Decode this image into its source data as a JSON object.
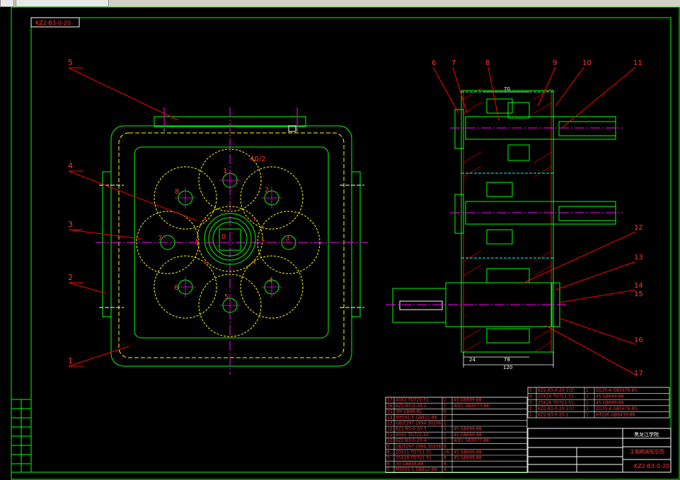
{
  "drawing": {
    "code_label": "KZ2-B3-0-20",
    "title_code": "KZ2-B3-0-20",
    "school": "黑龙江学院",
    "drawing_name": "主轴箱装配总图"
  },
  "front_view": {
    "leaders": [
      "5",
      "4",
      "3",
      "2",
      "1"
    ],
    "gear_labels": [
      "1",
      "2",
      "3",
      "4",
      "5",
      "6",
      "7",
      "8",
      "0"
    ],
    "annotation": "40/2"
  },
  "side_view": {
    "leaders": [
      "6",
      "7",
      "8",
      "9",
      "10",
      "11",
      "12",
      "13",
      "14",
      "15",
      "16",
      "17"
    ],
    "dims": [
      "70",
      "24",
      "78",
      "120"
    ]
  },
  "parts_list": [
    {
      "no": "17",
      "code": "40X2 TD721-51",
      "qty": "2",
      "material": "45 GB699-88"
    },
    {
      "no": "16",
      "code": "KZ2-B3-0-20-2",
      "qty": "1",
      "material": "40Cr GB3077-88"
    },
    {
      "no": "15",
      "code": "3M GB68-85",
      "qty": "6",
      "material": ""
    },
    {
      "no": "14",
      "code": "M30X1.5 GB812-88",
      "qty": "1",
      "material": ""
    },
    {
      "no": "13",
      "code": "GB/T297-1994 30206",
      "qty": "1",
      "material": ""
    },
    {
      "no": "12",
      "code": "KZ2-B3-0-20-3",
      "qty": "1",
      "material": "45 GB699-88"
    },
    {
      "no": "11",
      "code": "40X2 TD721-52",
      "qty": "1",
      "material": "45 GB699-88"
    },
    {
      "no": "10",
      "code": "KZ2-B3-0-20-4",
      "qty": "1",
      "material": "40Cr GB3077-88"
    },
    {
      "no": "9",
      "code": "GB/T297-1994 30206",
      "qty": "8",
      "material": ""
    },
    {
      "no": "8",
      "code": "20X11 TD721-51",
      "qty": "16",
      "material": "45 GB699-88"
    },
    {
      "no": "7",
      "code": "25X26 TD721-51",
      "qty": "8",
      "material": "45 GB699-88"
    },
    {
      "no": "6",
      "code": "30 GB858-88",
      "qty": "8",
      "material": ""
    },
    {
      "no": "5",
      "code": "M30X1.5 GB812-88",
      "qty": "8",
      "material": ""
    }
  ],
  "parts_list_right": [
    {
      "no": "5",
      "code": "KZ2-B3-0-20-1(2)",
      "qty": "1",
      "material": "ZG35-A GB5676-85"
    },
    {
      "no": "4",
      "code": "25X26 TD721-51",
      "qty": "1",
      "material": "45 GB699-88"
    },
    {
      "no": "3",
      "code": "25X26 TD721-51",
      "qty": "1",
      "material": "45 GB699-88"
    },
    {
      "no": "2",
      "code": "KZ2-B3-0-20-1(1)",
      "qty": "1",
      "material": "ZG35-A GB5676-85"
    },
    {
      "no": "1",
      "code": "KZ2-B3-0-20-1",
      "qty": "1",
      "material": "HT200 GB9439-88"
    }
  ],
  "colors": {
    "frame": "#00ff00",
    "center": "#ff00ff",
    "yellow": "#ffff00",
    "red": "#ff0000",
    "white": "#ffffff",
    "cyan": "#00ffff"
  }
}
